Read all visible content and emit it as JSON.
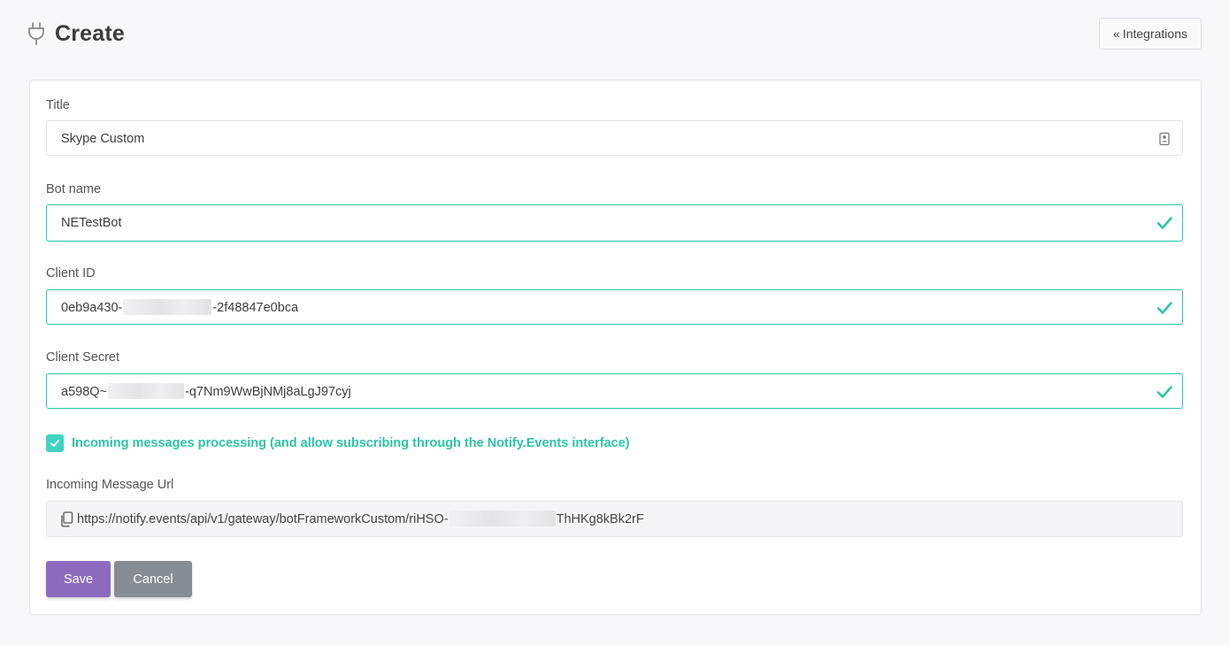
{
  "header": {
    "title": "Create",
    "back_label": "Integrations"
  },
  "form": {
    "title": {
      "label": "Title",
      "value": "Skype Custom"
    },
    "bot_name": {
      "label": "Bot name",
      "value": "NETestBot"
    },
    "client_id": {
      "label": "Client ID",
      "value_start": "0eb9a430-",
      "value_end": "-2f48847e0bca"
    },
    "client_secret": {
      "label": "Client Secret",
      "value_start": "a598Q~",
      "value_end": "-q7Nm9WwBjNMj8aLgJ97cyj"
    },
    "incoming_processing": {
      "checked": true,
      "label": "Incoming messages processing (and allow subscribing through the Notify.Events interface)"
    },
    "incoming_url": {
      "label": "Incoming Message Url",
      "value_start": "https://notify.events/api/v1/gateway/botFrameworkCustom/riHSO-",
      "value_end": "ThHKg8kBk2rF"
    }
  },
  "actions": {
    "save_label": "Save",
    "cancel_label": "Cancel"
  },
  "colors": {
    "accent_teal": "#2cc5a7",
    "save_purple": "#8c6bbf",
    "cancel_gray": "#868d93"
  }
}
